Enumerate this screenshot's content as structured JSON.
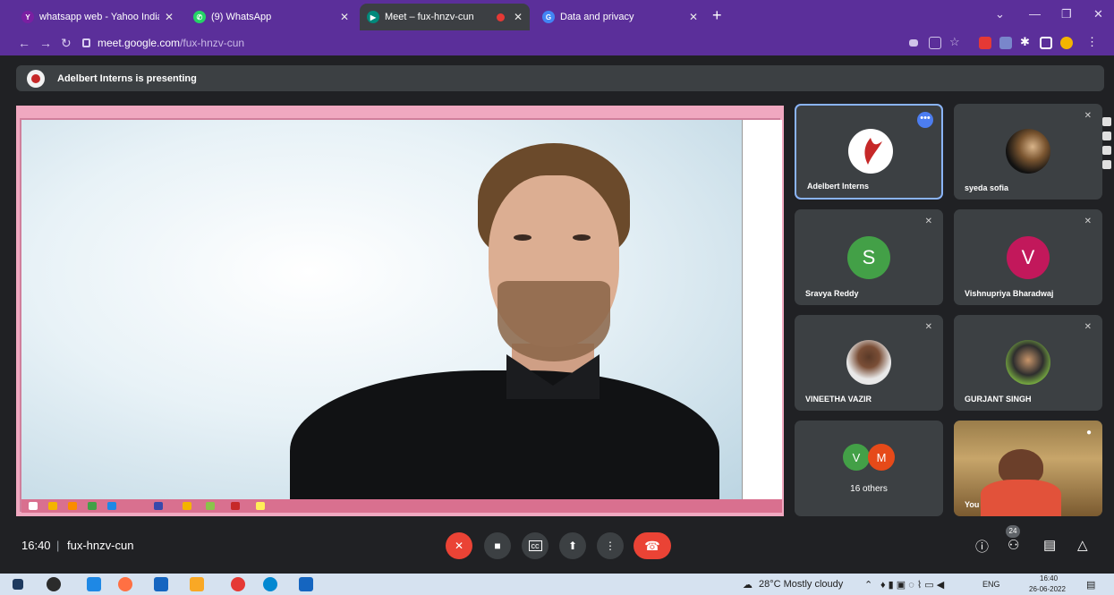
{
  "browser": {
    "tabs": [
      {
        "title": "whatsapp web - Yahoo India Sea",
        "favicon": "yahoo-icon",
        "color": "#7b1fa2",
        "active": false
      },
      {
        "title": "(9) WhatsApp",
        "favicon": "whatsapp-icon",
        "color": "#25d366",
        "active": false
      },
      {
        "title": "Meet – fux-hnzv-cun",
        "favicon": "meet-icon",
        "color": "#00897b",
        "active": true
      },
      {
        "title": "Data and privacy",
        "favicon": "google-icon",
        "color": "#4285f4",
        "active": false
      }
    ],
    "new_tab": "+",
    "url_host": "meet.google.com",
    "url_path": "/fux-hnzv-cun"
  },
  "meet": {
    "presenting_text": "Adelbert Interns is presenting",
    "participants": [
      {
        "name": "Adelbert Interns",
        "type": "logo"
      },
      {
        "name": "syeda sofia",
        "type": "photo"
      },
      {
        "name": "Sravya Reddy",
        "initial": "S",
        "color": "#43a047",
        "type": "letter"
      },
      {
        "name": "Vishnupriya Bharadwaj",
        "initial": "V",
        "color": "#c2185b",
        "type": "letter"
      },
      {
        "name": "VINEETHA VAZIR",
        "type": "photo"
      },
      {
        "name": "GURJANT SINGH",
        "type": "photo"
      }
    ],
    "others": {
      "label": "16 others",
      "avatars": [
        {
          "initial": "V",
          "color": "#43a047"
        },
        {
          "initial": "M",
          "color": "#e64a19"
        }
      ]
    },
    "self_label": "You",
    "more_options": "•••"
  },
  "bottom": {
    "time": "16:40",
    "separator": "|",
    "meeting_code": "fux-hnzv-cun",
    "participant_count": "24"
  },
  "taskbar": {
    "weather": "28°C  Mostly cloudy",
    "lang": "ENG",
    "clock_time": "16:40",
    "clock_date": "26-06-2022"
  },
  "colors": {
    "accent": "#5b2f9a",
    "meet_bg": "#202124",
    "tile_bg": "#3c4043",
    "danger": "#ea4335",
    "selected_border": "#8ab4f8"
  }
}
